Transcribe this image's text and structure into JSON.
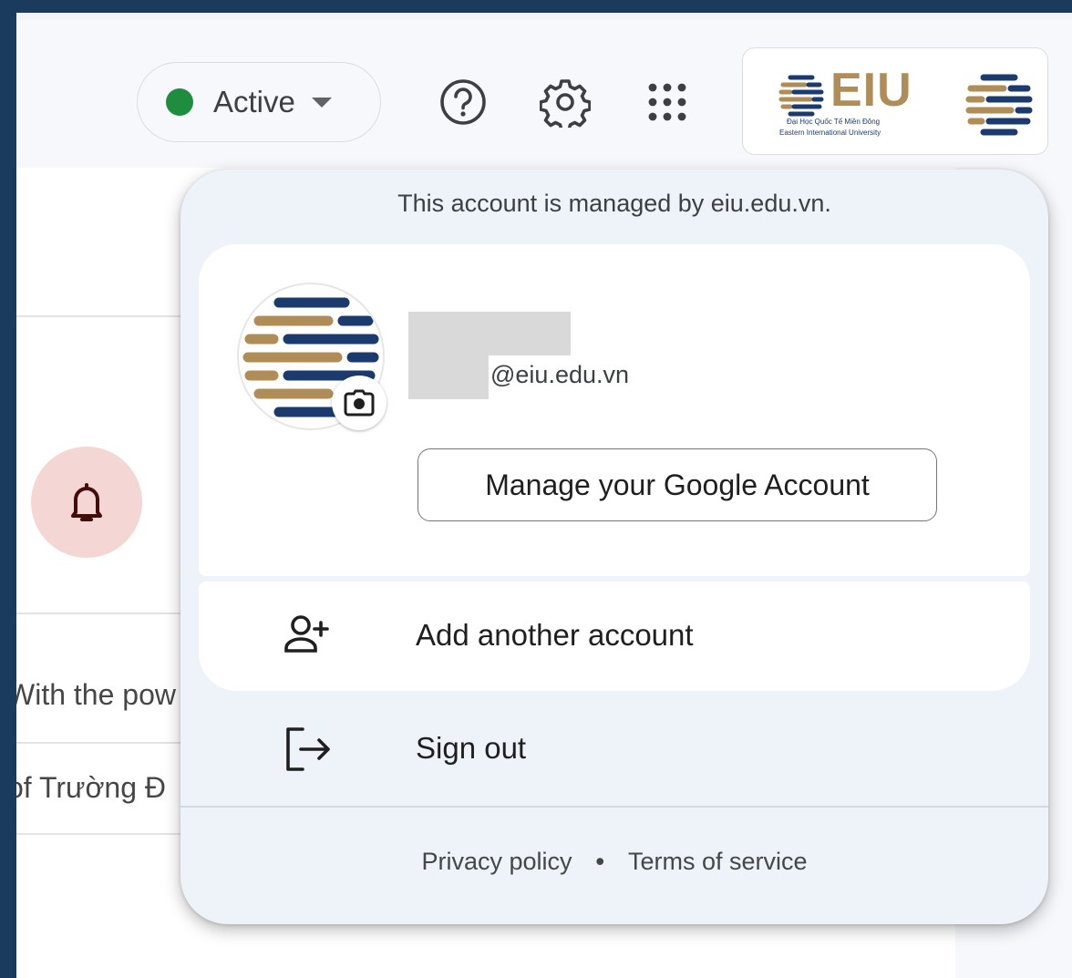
{
  "header": {
    "status_label": "Active",
    "status_color": "#1e8e3e",
    "icons": [
      "help-icon",
      "settings-gear-icon",
      "apps-grid-icon"
    ],
    "logo": {
      "wordmark": "EIU",
      "subtitle_vi": "Đại Học Quốc Tế Miền Đông",
      "subtitle_en": "Eastern International University",
      "brand_gold": "#b08d57",
      "brand_navy": "#1b3b6f"
    }
  },
  "background": {
    "row1_text": "With the pow",
    "row2_text": "of Trường Đ",
    "bell_color": "#f4d7d4"
  },
  "popup": {
    "managed_notice": "This account is managed by eiu.edu.vn.",
    "email_domain": "@eiu.edu.vn",
    "manage_button": "Manage your Google Account",
    "add_account": "Add another account",
    "sign_out": "Sign out",
    "footer": {
      "privacy": "Privacy policy",
      "separator": "•",
      "terms": "Terms of service"
    }
  }
}
